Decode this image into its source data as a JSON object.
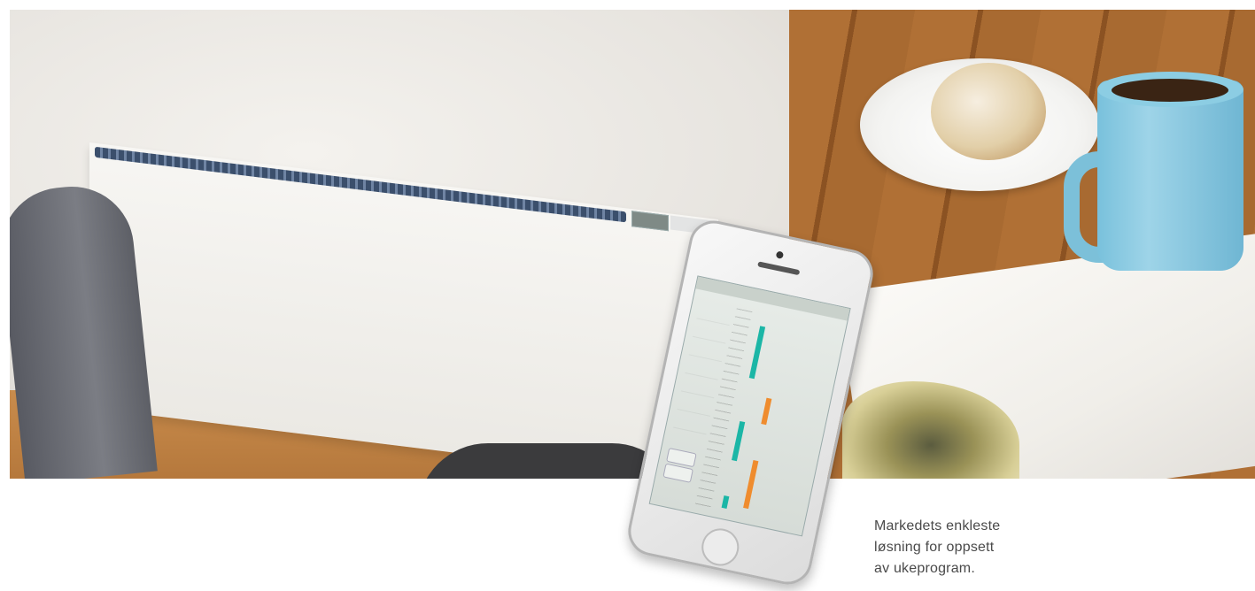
{
  "caption": {
    "line1": "Markedets enkleste",
    "line2": "løsning for oppsett",
    "line3": "av ukeprogram."
  },
  "colors": {
    "bar_teal": "#1bb6a6",
    "bar_orange": "#ef8c2e"
  }
}
